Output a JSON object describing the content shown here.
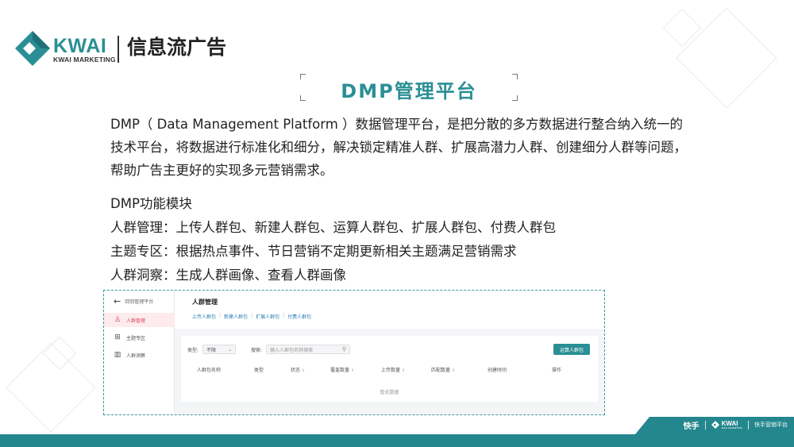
{
  "brand": {
    "name": "KWAI",
    "subtitle": "KWAI MARKETING",
    "section_title": "信息流广告",
    "colors": {
      "teal": "#2a8f95",
      "dark_teal": "#23878d",
      "accent_red": "#e0475a"
    }
  },
  "title": "DMP管理平台",
  "description": [
    "DMP（ Data Management Platform ）数据管理平台，是把分散的多方数据进行整合纳入统一的",
    "技术平台，将数据进行标准化和细分，解决锁定精准人群、扩展高潜力人群、创建细分人群等问题，",
    "帮助广告主更好的实现多元营销需求。"
  ],
  "modules": {
    "heading": "DMP功能模块",
    "items": [
      "人群管理：上传人群包、新建人群包、运算人群包、扩展人群包、付费人群包",
      "主题专区：根据热点事件、节日营销不定期更新相关主题满足营销需求",
      "人群洞察：生成人群画像、查看人群画像"
    ]
  },
  "screenshot": {
    "back_label": "回到管理平台",
    "sidebar": [
      {
        "label": "人群管理",
        "icon": "person-icon",
        "active": true
      },
      {
        "label": "主题专区",
        "icon": "grid-icon",
        "active": false
      },
      {
        "label": "人群洞察",
        "icon": "bar-chart-icon",
        "active": false
      }
    ],
    "page_title": "人群管理",
    "sub_nav": [
      "上传人群包",
      "新建人群包",
      "扩展人群包",
      "付费人群包"
    ],
    "filter": {
      "type_label": "类型:",
      "type_value": "不限",
      "search_label": "搜索:",
      "search_placeholder": "输入人群包名称搜索",
      "calc_button": "运算人群包"
    },
    "columns": [
      "人群包名称",
      "类型",
      "状态",
      "覆盖数量",
      "上传数量",
      "匹配数量",
      "创建时间",
      "操作"
    ],
    "sortable": [
      false,
      false,
      true,
      true,
      true,
      true,
      false,
      false
    ],
    "empty_text": "暂无数据"
  },
  "footer": {
    "kuaishou": "快手",
    "mini_logo": "KWAI",
    "mini_logo_sub": "KWAI MARKETING",
    "platform": "快手营销平台"
  }
}
